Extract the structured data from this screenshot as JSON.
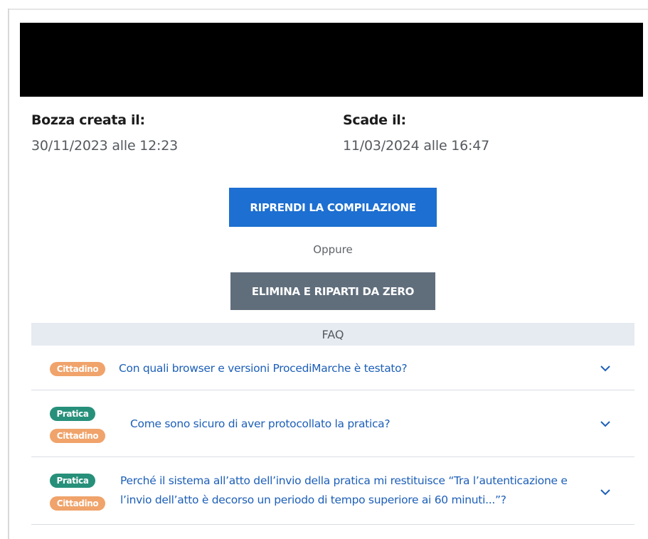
{
  "draft": {
    "created_label": "Bozza creata il:",
    "created_value": "30/11/2023 alle 12:23",
    "expires_label": "Scade il:",
    "expires_value": "11/03/2024 alle 16:47"
  },
  "actions": {
    "resume_label": "RIPRENDI LA COMPILAZIONE",
    "or_label": "Oppure",
    "delete_label": "ELIMINA E RIPARTI DA ZERO"
  },
  "faq": {
    "title": "FAQ",
    "items": [
      {
        "tags": [
          "Cittadino"
        ],
        "question": "Con quali browser e versioni ProcediMarche è testato?"
      },
      {
        "tags": [
          "Pratica",
          "Cittadino"
        ],
        "question": "Come sono sicuro di aver protocollato la pratica?"
      },
      {
        "tags": [
          "Pratica",
          "Cittadino"
        ],
        "question_line1": "Perché il sistema all’atto dell’invio della pratica mi restituisce “Tra l’autenticazione e",
        "question_line2": "l’invio dell’atto è decorso un periodo di tempo superiore ai 60 minuti...”?"
      }
    ]
  },
  "colors": {
    "primary": "#1d6fd1",
    "secondary": "#606e7c",
    "badge_cittadino": "#f0a36a",
    "badge_pratica": "#27907a",
    "link": "#1d5fb8"
  },
  "icons": {
    "expand": "chevron-down-icon"
  }
}
